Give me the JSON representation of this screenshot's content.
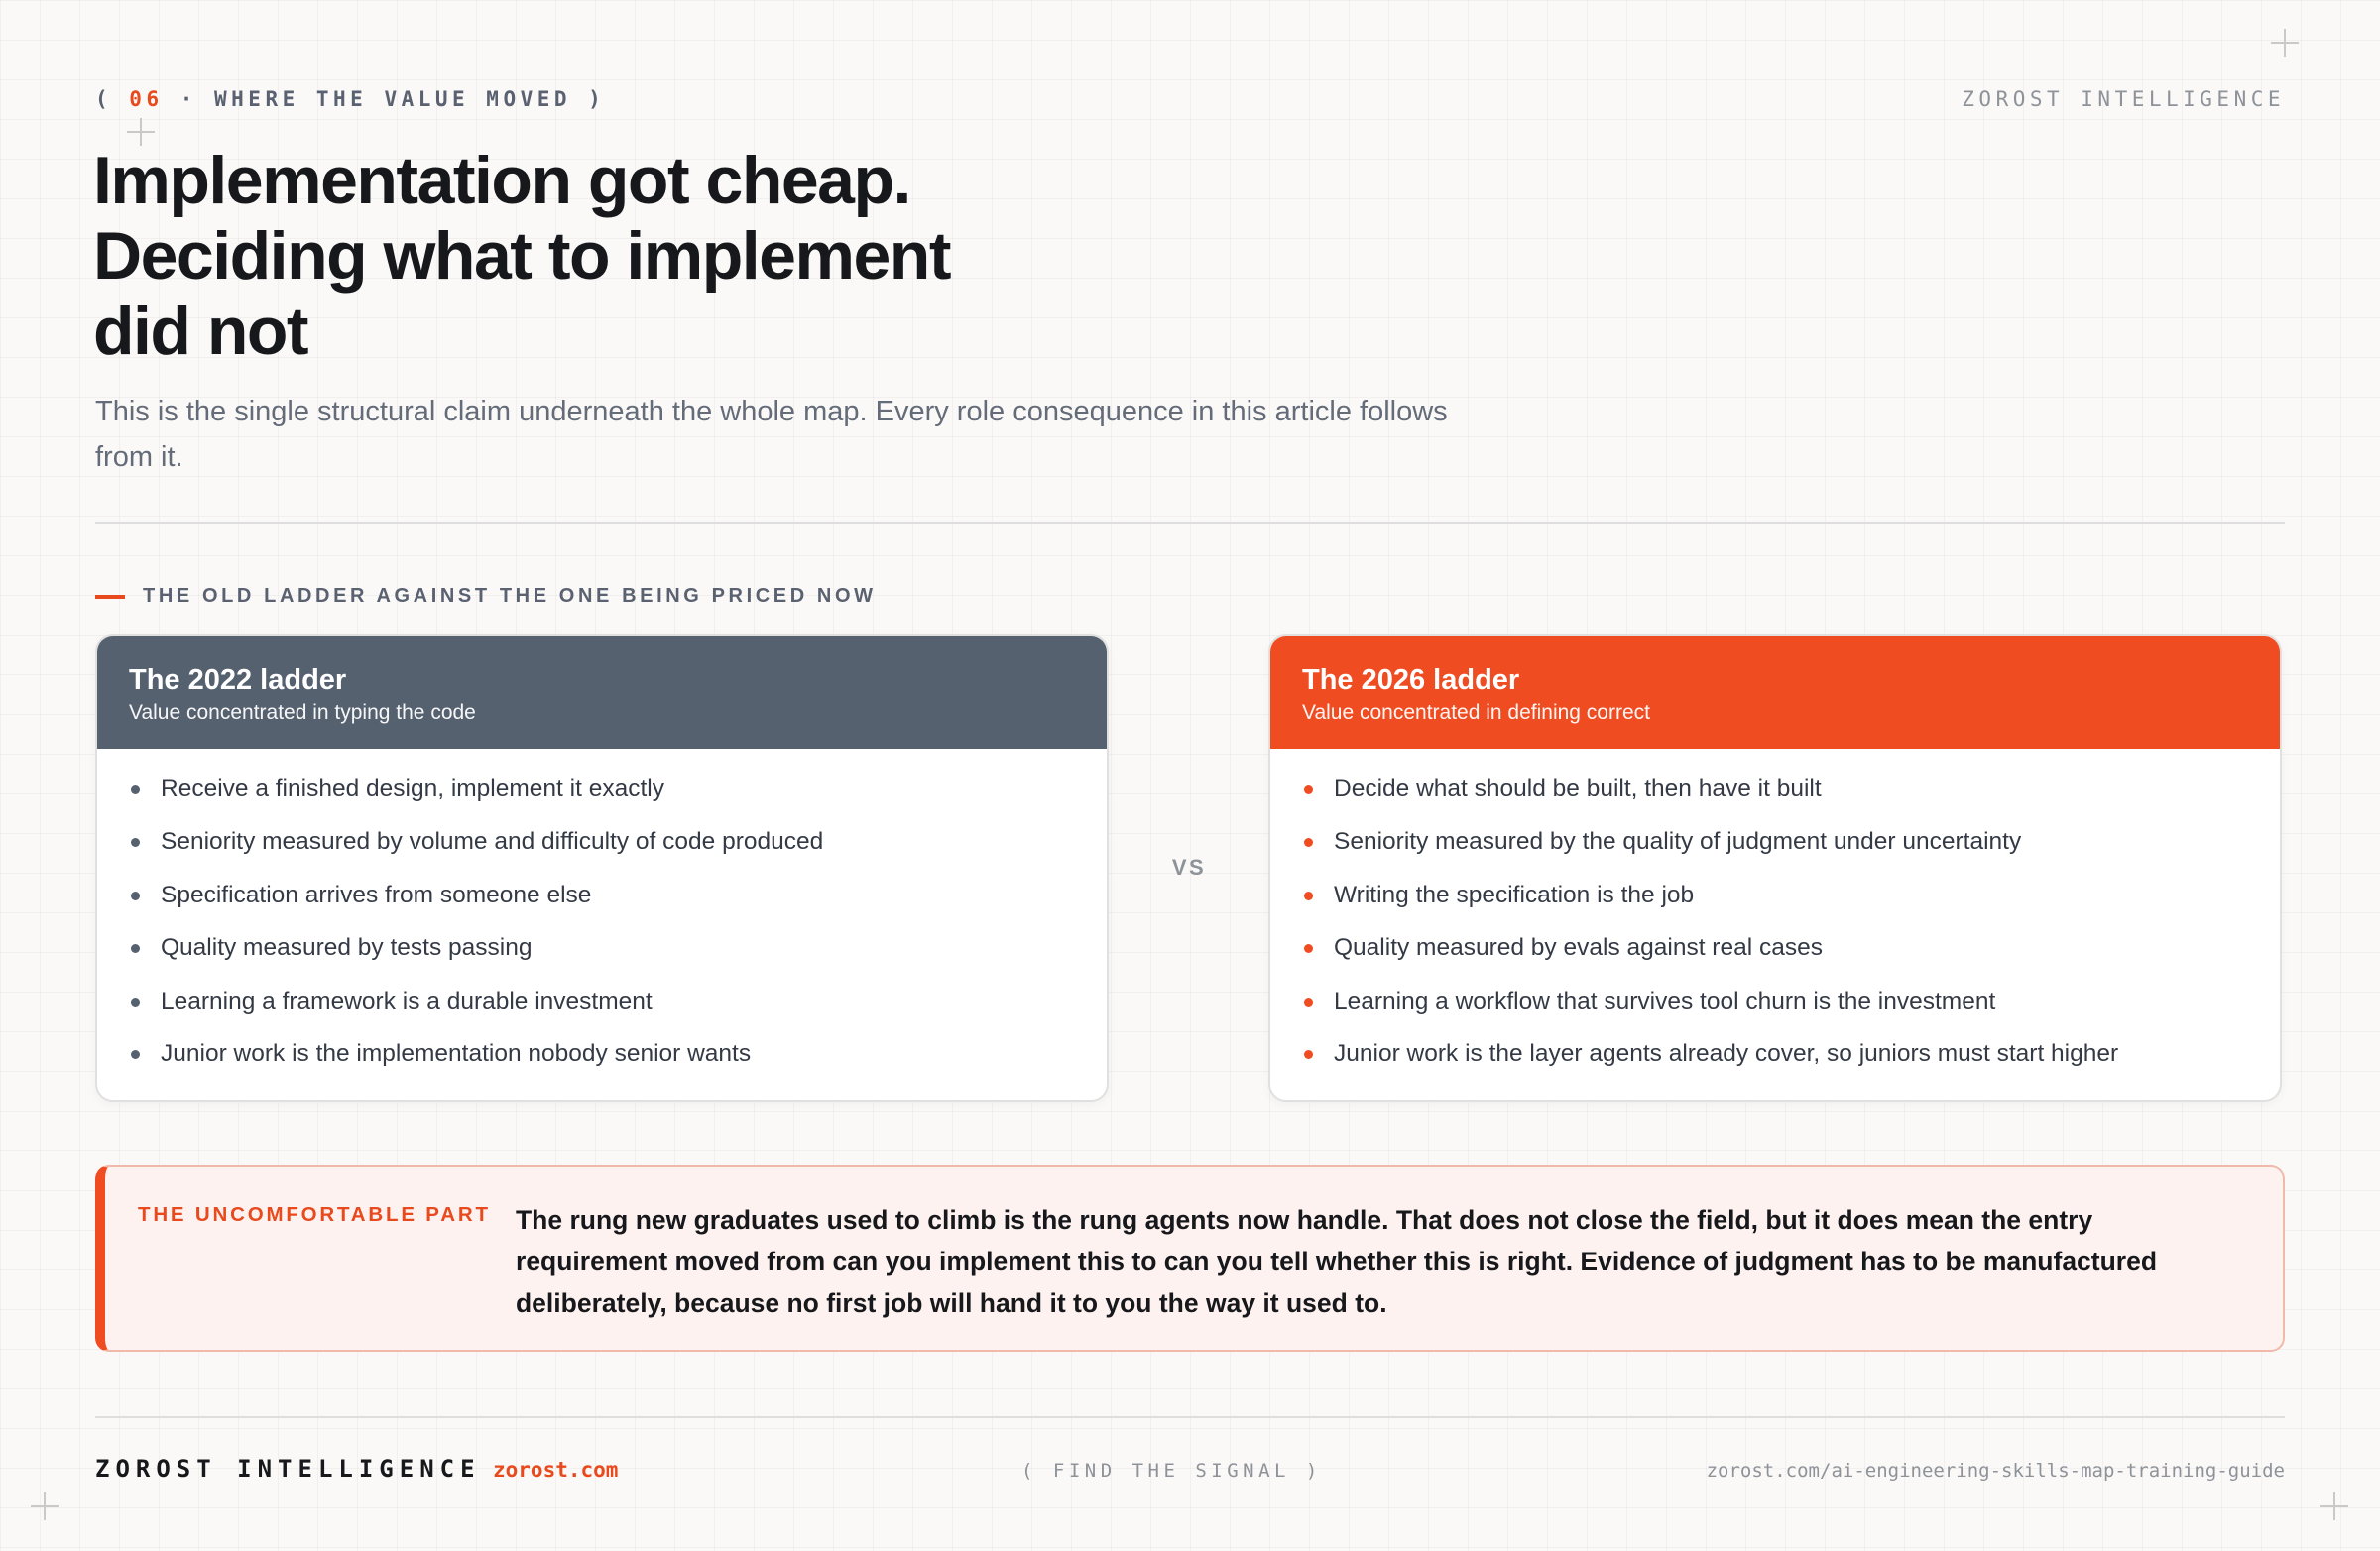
{
  "header": {
    "eyebrow_open": "( ",
    "section_number": "06",
    "eyebrow_rest": " · WHERE THE VALUE MOVED )",
    "brand": "ZOROST INTELLIGENCE"
  },
  "headline": {
    "line1": "Implementation got cheap.",
    "line2": "Deciding what to implement",
    "line3": "did not"
  },
  "subhead": "This is the single structural claim underneath the whole map. Every role consequence in this article follows from it.",
  "section_label": "THE OLD LADDER AGAINST THE ONE BEING PRICED NOW",
  "comparison": {
    "left": {
      "title": "The 2022 ladder",
      "subtitle": "Value concentrated in typing the code",
      "items": [
        "Receive a finished design, implement it exactly",
        "Seniority measured by volume and difficulty of code produced",
        "Specification arrives from someone else",
        "Quality measured by tests passing",
        "Learning a framework is a durable investment",
        "Junior work is the implementation nobody senior wants"
      ]
    },
    "vs": "VS",
    "right": {
      "title": "The 2026 ladder",
      "subtitle": "Value concentrated in defining correct",
      "items": [
        "Decide what should be built, then have it built",
        "Seniority measured by the quality of judgment under uncertainty",
        "Writing the specification is the job",
        "Quality measured by evals against real cases",
        "Learning a workflow that survives tool churn is the investment",
        "Junior work is the layer agents already cover, so juniors must start higher"
      ]
    }
  },
  "callout": {
    "label": "THE UNCOMFORTABLE PART",
    "text": "The rung new graduates used to climb is the rung agents now handle. That does not close the field, but it does mean the entry requirement moved from can you implement this to can you tell whether this is right. Evidence of judgment has to be manufactured deliberately, because no first job will hand it to you the way it used to."
  },
  "footer": {
    "brand": "ZOROST INTELLIGENCE",
    "site": "zorost.com",
    "tagline": "( FIND THE SIGNAL )",
    "url": "zorost.com/ai-engineering-skills-map-training-guide"
  },
  "colors": {
    "accent": "#f04c22",
    "slate": "#566170",
    "background": "#faf9f7"
  }
}
